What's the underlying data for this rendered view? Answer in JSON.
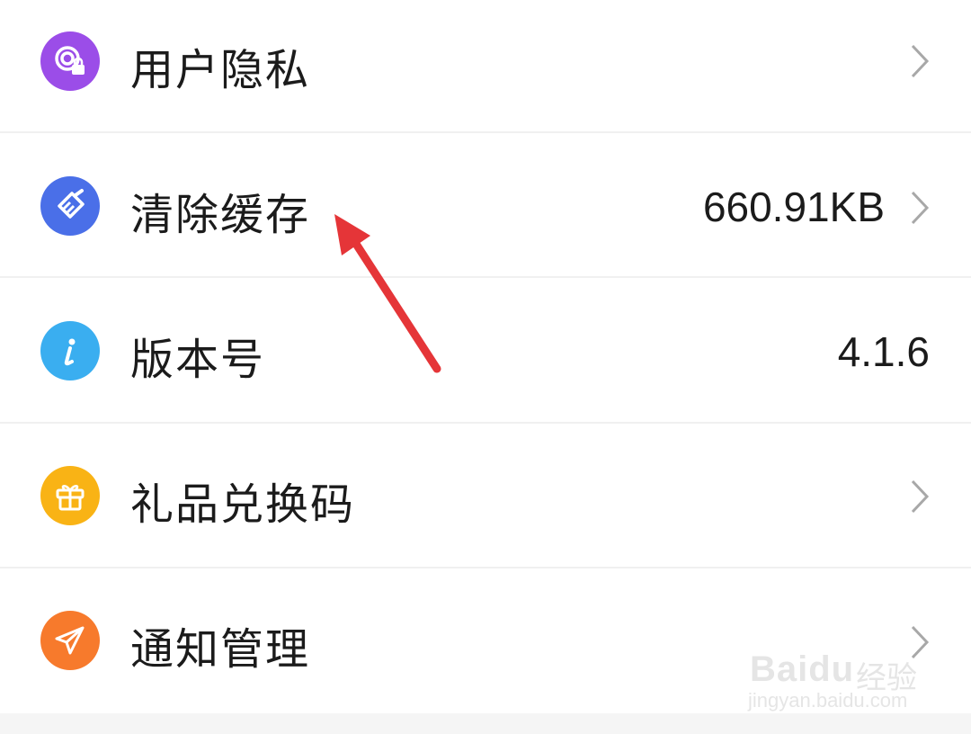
{
  "settings": {
    "items": [
      {
        "label": "用户隐私",
        "icon": "privacy-lock-icon",
        "color": "#9b4de8",
        "value": "",
        "has_chevron": true
      },
      {
        "label": "清除缓存",
        "icon": "broom-icon",
        "color": "#4a6fe8",
        "value": "660.91KB",
        "has_chevron": true
      },
      {
        "label": "版本号",
        "icon": "info-icon",
        "color": "#3aaef0",
        "value": "4.1.6",
        "has_chevron": false
      },
      {
        "label": "礼品兑换码",
        "icon": "gift-icon",
        "color": "#f9b315",
        "value": "",
        "has_chevron": true
      },
      {
        "label": "通知管理",
        "icon": "paper-plane-icon",
        "color": "#f77a2c",
        "value": "",
        "has_chevron": true
      }
    ]
  },
  "annotation": {
    "color": "#e53538"
  },
  "watermark": {
    "brand": "Baidu",
    "cn": "经验",
    "url": "jingyan.baidu.com"
  }
}
